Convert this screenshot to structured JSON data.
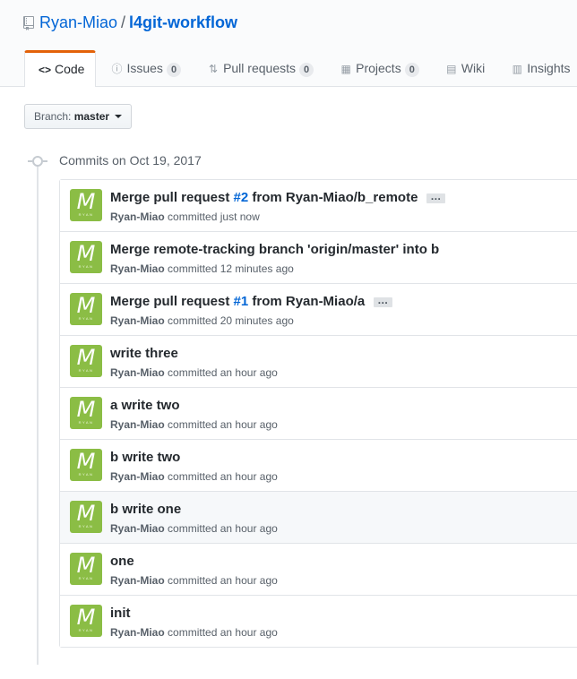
{
  "repo": {
    "owner": "Ryan-Miao",
    "separator": "/",
    "name": "l4git-workflow"
  },
  "tabs": [
    {
      "label": "Code",
      "icon": "code-icon",
      "glyph": "<>",
      "count": ""
    },
    {
      "label": "Issues",
      "icon": "issue-icon",
      "glyph": "ⓘ",
      "count": "0"
    },
    {
      "label": "Pull requests",
      "icon": "pull-request-icon",
      "glyph": "⇅",
      "count": "0"
    },
    {
      "label": "Projects",
      "icon": "project-icon",
      "glyph": "▦",
      "count": "0"
    },
    {
      "label": "Wiki",
      "icon": "book-icon",
      "glyph": "▤",
      "count": ""
    },
    {
      "label": "Insights",
      "icon": "graph-icon",
      "glyph": "▥",
      "count": ""
    }
  ],
  "branch": {
    "prefix": "Branch:",
    "name": "master"
  },
  "date_heading": "Commits on Oct 19, 2017",
  "avatar": {
    "letter": "M",
    "text": "RYAN",
    "color": "#8bbd45"
  },
  "commits": [
    {
      "pre": "Merge pull request ",
      "issue": "#2",
      "post": " from Ryan-Miao/b_remote",
      "ellipsis": "…",
      "author": "Ryan-Miao",
      "verb": "committed",
      "time": "just now"
    },
    {
      "pre": "Merge remote-tracking branch 'origin/master' into b",
      "issue": "",
      "post": "",
      "ellipsis": "",
      "author": "Ryan-Miao",
      "verb": "committed",
      "time": "12 minutes ago"
    },
    {
      "pre": "Merge pull request ",
      "issue": "#1",
      "post": " from Ryan-Miao/a",
      "ellipsis": "…",
      "author": "Ryan-Miao",
      "verb": "committed",
      "time": "20 minutes ago"
    },
    {
      "pre": "write three",
      "issue": "",
      "post": "",
      "ellipsis": "",
      "author": "Ryan-Miao",
      "verb": "committed",
      "time": "an hour ago"
    },
    {
      "pre": "a write two",
      "issue": "",
      "post": "",
      "ellipsis": "",
      "author": "Ryan-Miao",
      "verb": "committed",
      "time": "an hour ago"
    },
    {
      "pre": "b write two",
      "issue": "",
      "post": "",
      "ellipsis": "",
      "author": "Ryan-Miao",
      "verb": "committed",
      "time": "an hour ago"
    },
    {
      "pre": "b write one",
      "issue": "",
      "post": "",
      "ellipsis": "",
      "author": "Ryan-Miao",
      "verb": "committed",
      "time": "an hour ago"
    },
    {
      "pre": "one",
      "issue": "",
      "post": "",
      "ellipsis": "",
      "author": "Ryan-Miao",
      "verb": "committed",
      "time": "an hour ago"
    },
    {
      "pre": "init",
      "issue": "",
      "post": "",
      "ellipsis": "",
      "author": "Ryan-Miao",
      "verb": "committed",
      "time": "an hour ago"
    }
  ],
  "colors": {
    "link": "#0366d6",
    "tab_accent": "#e36209",
    "avatar": "#8bbd45"
  }
}
